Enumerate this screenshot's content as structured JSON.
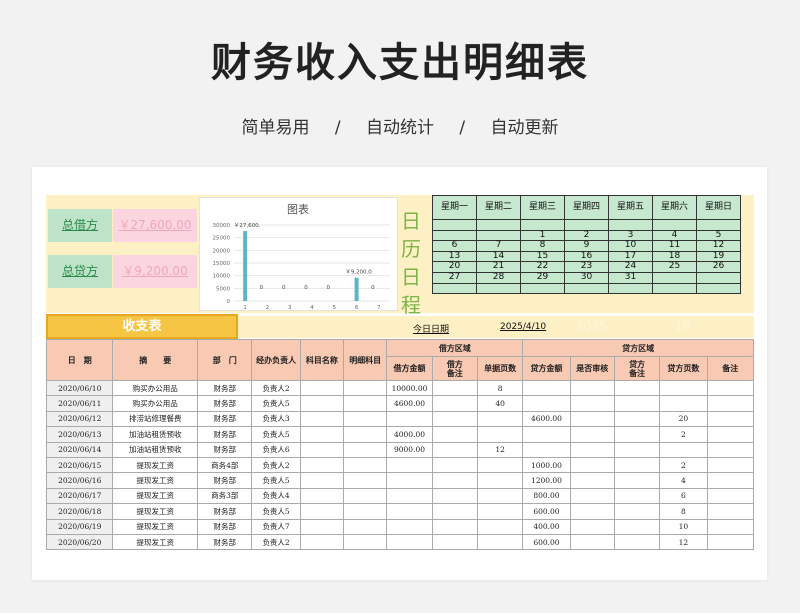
{
  "page": {
    "title": "财务收入支出明细表",
    "subtitle": [
      "简单易用",
      "/",
      "自动统计",
      "/",
      "自动更新"
    ]
  },
  "summary": {
    "debit_label": "总借方",
    "debit_value": "￥27,600.00",
    "credit_label": "总贷方",
    "credit_value": "￥9,200.00"
  },
  "colors": {
    "accent_yellow": "#f6c544",
    "header_pink": "#f8c9b3",
    "calendar_green": "#c6e8cf",
    "chart_bar": "#5bb5c8"
  },
  "chart_data": {
    "type": "bar",
    "title": "图表",
    "categories": [
      "1",
      "2",
      "3",
      "4",
      "5",
      "6",
      "7"
    ],
    "series": [
      {
        "values": [
          27600,
          0,
          0,
          0,
          0,
          9200,
          0
        ]
      }
    ],
    "data_labels": [
      "￥27,600.",
      "0",
      "0",
      "0",
      "0",
      "￥9,200.0",
      "0"
    ],
    "ylim": [
      0,
      30000
    ],
    "yticks": [
      "0",
      "5000",
      "10000",
      "15000",
      "20000",
      "25000",
      "30000"
    ],
    "grid": true
  },
  "calendar": {
    "side_label": [
      "日",
      "历",
      "日",
      "程"
    ],
    "headers": [
      "星期一",
      "星期二",
      "星期三",
      "星期四",
      "星期五",
      "星期六",
      "星期日"
    ],
    "rows": [
      [
        "",
        "",
        "",
        "",
        "",
        "",
        ""
      ],
      [
        "",
        "",
        "1",
        "2",
        "3",
        "4",
        "5"
      ],
      [
        "6",
        "7",
        "8",
        "9",
        "10",
        "11",
        "12"
      ],
      [
        "13",
        "14",
        "15",
        "16",
        "17",
        "18",
        "19"
      ],
      [
        "20",
        "21",
        "22",
        "23",
        "24",
        "25",
        "26"
      ],
      [
        "27",
        "28",
        "29",
        "30",
        "31",
        "",
        ""
      ],
      [
        "",
        "",
        "",
        "",
        "",
        "",
        ""
      ]
    ]
  },
  "ledger": {
    "title": "收支表",
    "today_label": "今日日期",
    "today_value": "2025/4/10",
    "today_year": "2025",
    "today_day": "10",
    "group_debit": "借方区域",
    "group_credit": "贷方区域",
    "headers": [
      "日　期",
      "摘　　要",
      "部　门",
      "经办负责人",
      "科目名称",
      "明细科目"
    ],
    "debit_headers": [
      "借方金额",
      "借方\n备注",
      "单据页数"
    ],
    "credit_headers": [
      "贷方金额",
      "是否审核",
      "贷方\n备注",
      "贷方页数",
      "备注"
    ],
    "rows": [
      [
        "2020/06/10",
        "购买办公用品",
        "财务部",
        "负责人2",
        "",
        "",
        "10000.00",
        "",
        "8",
        "",
        "",
        "",
        "",
        ""
      ],
      [
        "2020/06/11",
        "购买办公用品",
        "财务部",
        "负责人5",
        "",
        "",
        "4600.00",
        "",
        "40",
        "",
        "",
        "",
        "",
        ""
      ],
      [
        "2020/06/12",
        "排涝站修理餐费",
        "财务部",
        "负责人3",
        "",
        "",
        "",
        "",
        "",
        "4600.00",
        "",
        "",
        "20",
        ""
      ],
      [
        "2020/06/13",
        "加油站租赁预收",
        "财务部",
        "负责人5",
        "",
        "",
        "4000.00",
        "",
        "",
        "",
        "",
        "",
        "2",
        ""
      ],
      [
        "2020/06/14",
        "加油站租赁预收",
        "财务部",
        "负责人6",
        "",
        "",
        "9000.00",
        "",
        "12",
        "",
        "",
        "",
        "",
        ""
      ],
      [
        "2020/06/15",
        "提现发工资",
        "商务4部",
        "负责人2",
        "",
        "",
        "",
        "",
        "",
        "1000.00",
        "",
        "",
        "2",
        ""
      ],
      [
        "2020/06/16",
        "提现发工资",
        "财务部",
        "负责人5",
        "",
        "",
        "",
        "",
        "",
        "1200.00",
        "",
        "",
        "4",
        ""
      ],
      [
        "2020/06/17",
        "提现发工资",
        "商务3部",
        "负责人4",
        "",
        "",
        "",
        "",
        "",
        "800.00",
        "",
        "",
        "6",
        ""
      ],
      [
        "2020/06/18",
        "提现发工资",
        "财务部",
        "负责人5",
        "",
        "",
        "",
        "",
        "",
        "600.00",
        "",
        "",
        "8",
        ""
      ],
      [
        "2020/06/19",
        "提现发工资",
        "财务部",
        "负责人7",
        "",
        "",
        "",
        "",
        "",
        "400.00",
        "",
        "",
        "10",
        ""
      ],
      [
        "2020/06/20",
        "提现发工资",
        "财务部",
        "负责人2",
        "",
        "",
        "",
        "",
        "",
        "600.00",
        "",
        "",
        "12",
        ""
      ]
    ]
  }
}
